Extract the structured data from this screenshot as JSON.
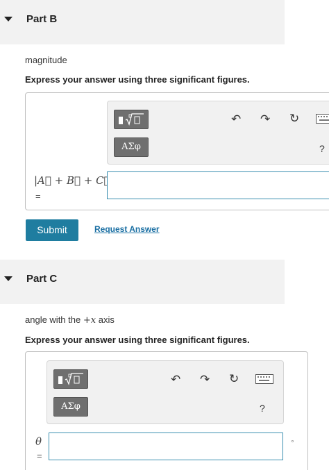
{
  "part_b": {
    "title": "Part B",
    "prompt": "magnitude",
    "instruction": "Express your answer using three significant figures.",
    "toolbar": {
      "greek_label": "ΑΣφ",
      "help": "?"
    },
    "expression": "|A⃗ + B⃗ + C⃗|",
    "equals": "=",
    "input_value": "",
    "submit_label": "Submit",
    "request_answer_label": "Request Answer"
  },
  "part_c": {
    "title": "Part C",
    "prompt_text": "angle with the",
    "prompt_math": "+x",
    "prompt_suffix": "axis",
    "instruction": "Express your answer using three significant figures.",
    "toolbar": {
      "greek_label": "ΑΣφ",
      "help": "?"
    },
    "variable": "θ",
    "equals": "=",
    "input_value": "",
    "unit": "°"
  },
  "colors": {
    "accent": "#1f7da0",
    "link": "#1a6fa3",
    "input_border": "#3a8fb0",
    "header_bg": "#f2f2f2"
  },
  "icons": [
    "caret-down-icon",
    "templates-icon",
    "undo-icon",
    "redo-icon",
    "reset-icon",
    "keyboard-icon"
  ]
}
